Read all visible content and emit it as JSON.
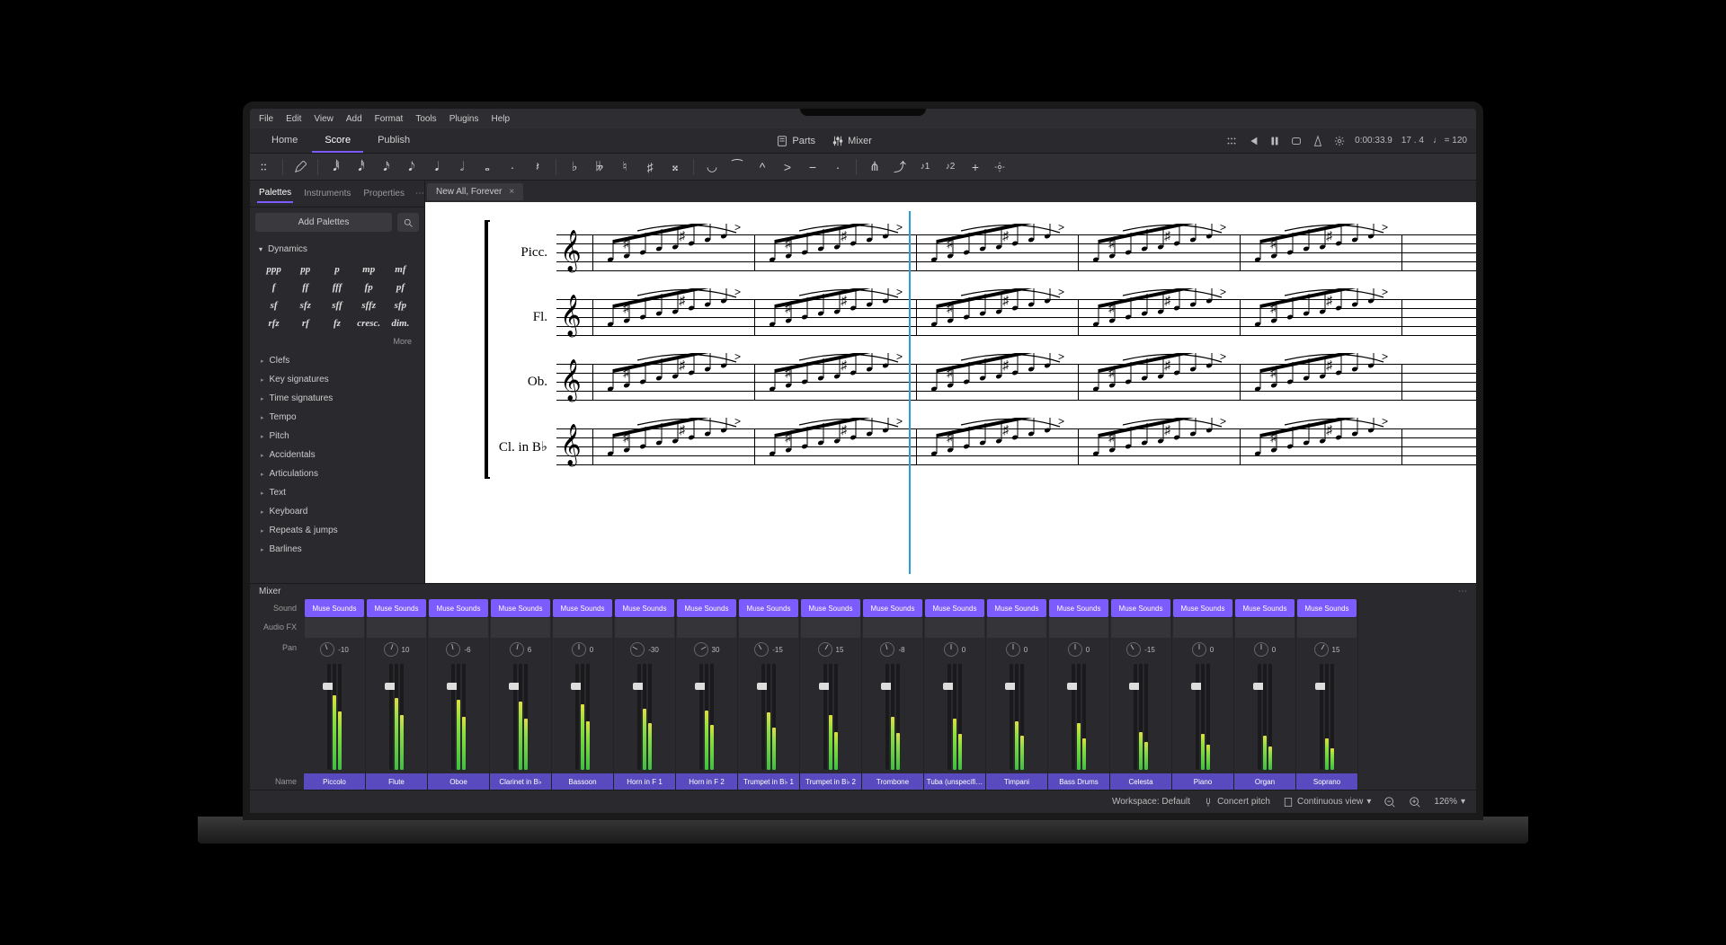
{
  "menu": [
    "File",
    "Edit",
    "View",
    "Add",
    "Format",
    "Tools",
    "Plugins",
    "Help"
  ],
  "mainTabs": {
    "items": [
      "Home",
      "Score",
      "Publish"
    ],
    "active": "Score"
  },
  "centerControls": {
    "parts": "Parts",
    "mixer": "Mixer"
  },
  "topRight": {
    "time": "0:00:33.9",
    "beat": "17 . 4",
    "tempo": "♩ = 120"
  },
  "panelTabs": [
    "Palettes",
    "Instruments",
    "Properties"
  ],
  "addPalettes": "Add Palettes",
  "dynamicsHeader": "Dynamics",
  "dynamics": [
    "ppp",
    "pp",
    "p",
    "mp",
    "mf",
    "f",
    "ff",
    "fff",
    "fp",
    "pf",
    "sf",
    "sfz",
    "sff",
    "sffz",
    "sfp",
    "rfz",
    "rf",
    "fz",
    "cresc.",
    "dim."
  ],
  "moreLabel": "More",
  "paletteCategories": [
    "Clefs",
    "Key signatures",
    "Time signatures",
    "Tempo",
    "Pitch",
    "Accidentals",
    "Articulations",
    "Text",
    "Keyboard",
    "Repeats & jumps",
    "Barlines"
  ],
  "docTab": "New All, Forever",
  "staves": [
    "Picc.",
    "Fl.",
    "Ob.",
    "Cl. in B♭"
  ],
  "mixerTitle": "Mixer",
  "mixerRowLabels": {
    "sound": "Sound",
    "fx": "Audio FX",
    "pan": "Pan",
    "name": "Name"
  },
  "channels": [
    {
      "name": "Piccolo",
      "sound": "Muse Sounds",
      "pan": -10,
      "meter": [
        70,
        55
      ]
    },
    {
      "name": "Flute",
      "sound": "Muse Sounds",
      "pan": 10,
      "meter": [
        68,
        52
      ]
    },
    {
      "name": "Oboe",
      "sound": "Muse Sounds",
      "pan": -6,
      "meter": [
        66,
        50
      ]
    },
    {
      "name": "Clarinet in B♭",
      "sound": "Muse Sounds",
      "pan": 6,
      "meter": [
        64,
        48
      ]
    },
    {
      "name": "Bassoon",
      "sound": "Muse Sounds",
      "pan": 0,
      "meter": [
        62,
        46
      ]
    },
    {
      "name": "Horn in F 1",
      "sound": "Muse Sounds",
      "pan": -30,
      "meter": [
        58,
        44
      ]
    },
    {
      "name": "Horn in F 2",
      "sound": "Muse Sounds",
      "pan": 30,
      "meter": [
        56,
        42
      ]
    },
    {
      "name": "Trumpet in B♭ 1",
      "sound": "Muse Sounds",
      "pan": -15,
      "meter": [
        54,
        40
      ]
    },
    {
      "name": "Trumpet in B♭ 2",
      "sound": "Muse Sounds",
      "pan": 15,
      "meter": [
        52,
        36
      ]
    },
    {
      "name": "Trombone",
      "sound": "Muse Sounds",
      "pan": -8,
      "meter": [
        50,
        35
      ]
    },
    {
      "name": "Tuba (unspecifi…",
      "sound": "Muse Sounds",
      "pan": 0,
      "meter": [
        48,
        34
      ]
    },
    {
      "name": "Timpani",
      "sound": "Muse Sounds",
      "pan": 0,
      "meter": [
        46,
        32
      ]
    },
    {
      "name": "Bass Drums",
      "sound": "Muse Sounds",
      "pan": 0,
      "meter": [
        44,
        30
      ]
    },
    {
      "name": "Celesta",
      "sound": "Muse Sounds",
      "pan": -15,
      "meter": [
        36,
        26
      ]
    },
    {
      "name": "Piano",
      "sound": "Muse Sounds",
      "pan": 0,
      "meter": [
        34,
        24
      ]
    },
    {
      "name": "Organ",
      "sound": "Muse Sounds",
      "pan": 0,
      "meter": [
        32,
        22
      ]
    },
    {
      "name": "Soprano",
      "sound": "Muse Sounds",
      "pan": 15,
      "meter": [
        30,
        20
      ]
    }
  ],
  "statusbar": {
    "workspace": "Workspace: Default",
    "concert": "Concert pitch",
    "view": "Continuous view",
    "zoom": "126%"
  }
}
